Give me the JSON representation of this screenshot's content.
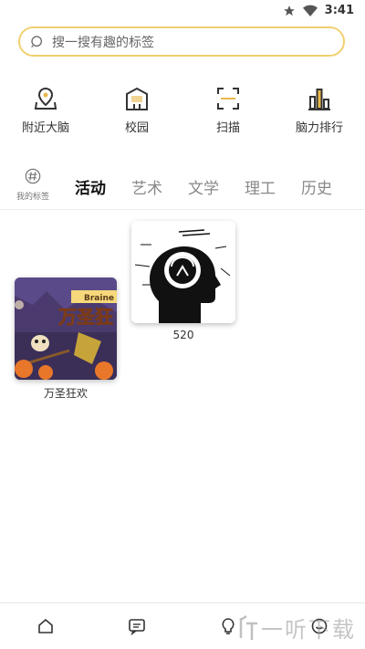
{
  "status_bar": {
    "time": "3:41",
    "icons": [
      "star-icon",
      "wifi-icon"
    ]
  },
  "search": {
    "placeholder": "搜一搜有趣的标签"
  },
  "quick_actions": [
    {
      "label": "附近大脑",
      "icon": "map-pin-icon"
    },
    {
      "label": "校园",
      "icon": "school-icon"
    },
    {
      "label": "扫描",
      "icon": "scan-icon"
    },
    {
      "label": "脑力排行",
      "icon": "ranking-icon"
    }
  ],
  "tabs": {
    "my_tags": "我的标签",
    "items": [
      "活动",
      "艺术",
      "文学",
      "理工",
      "历史"
    ],
    "active": "活动"
  },
  "cards": [
    {
      "label": "万圣狂欢",
      "image_text": "万圣狂",
      "banner_text": "Braine"
    },
    {
      "label": "520"
    }
  ],
  "bottom_nav": [
    "home-icon",
    "message-icon",
    "bulb-icon",
    "profile-icon"
  ],
  "watermark": "一听下载",
  "colors": {
    "accent": "#f0d070",
    "icon_line": "#333333",
    "icon_gold": "#e8b84a"
  }
}
